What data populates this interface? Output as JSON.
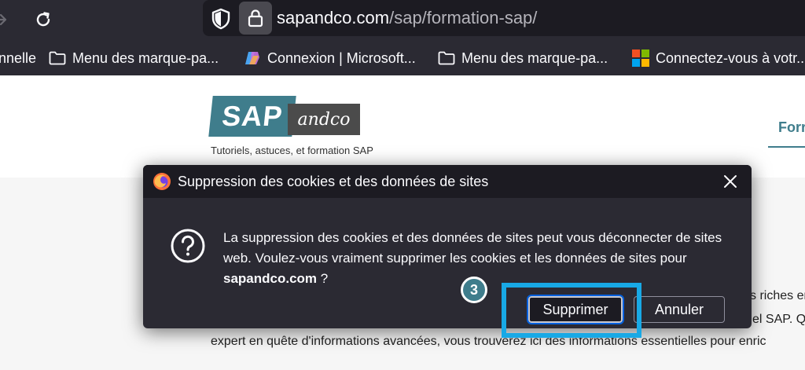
{
  "browser": {
    "url_domain": "sapandco.com",
    "url_path": "/sap/formation-sap/",
    "bookmarks": [
      {
        "label": "nnelle",
        "icon": "none"
      },
      {
        "label": "Menu des marque-pa...",
        "icon": "folder-icon"
      },
      {
        "label": "Connexion | Microsoft...",
        "icon": "copilot-icon"
      },
      {
        "label": "Menu des marque-pa...",
        "icon": "folder-icon"
      },
      {
        "label": "Connectez-vous à votr...",
        "icon": "microsoft-logo-icon"
      }
    ]
  },
  "site": {
    "logo_sap": "SAP",
    "logo_andco": "andco",
    "tagline": "Tutoriels, astuces, et formation SAP",
    "nav_partial": "Forr",
    "bg_text_right1": "s riches en",
    "bg_text_right2": "el SAP. Q",
    "bg_text_bottom": "expert en quête d'informations avancées, vous trouverez ici des informations essentielles pour enric"
  },
  "dialog": {
    "title": "Suppression des cookies et des données de sites",
    "message_part1": "La suppression des cookies et des données de sites peut vous déconnecter de sites web. Voulez-vous vraiment supprimer les cookies et les données de sites pour ",
    "message_domain": "sapandco.com",
    "message_part2": " ?",
    "confirm_label": "Supprimer",
    "cancel_label": "Annuler"
  },
  "annotation": {
    "step_number": "3",
    "highlight_color": "#18a9e6"
  },
  "colors": {
    "chrome_bg": "#2b2a33",
    "url_bg": "#1c1b22",
    "brand_teal": "#3f7d8c",
    "focus_blue": "#0060df"
  }
}
